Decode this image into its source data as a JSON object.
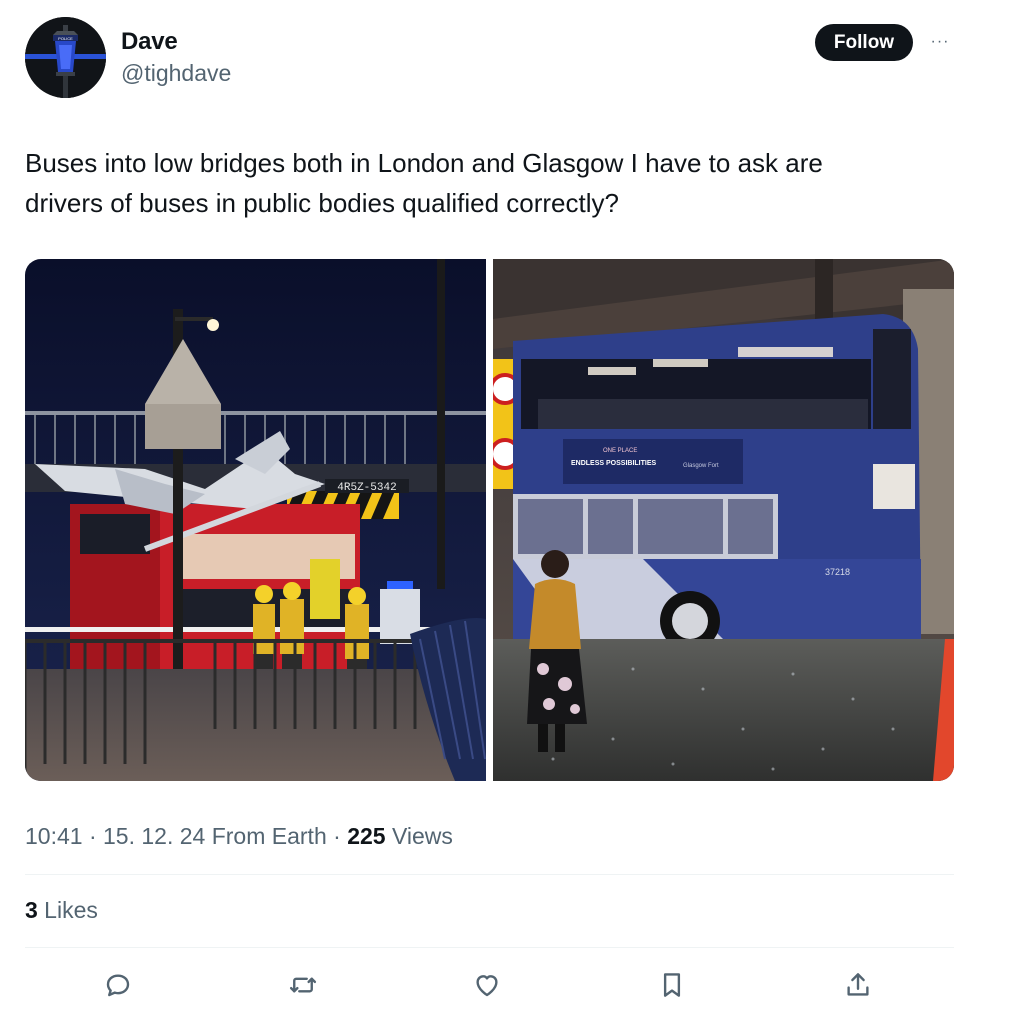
{
  "user": {
    "display_name": "Dave",
    "handle": "@tighdave",
    "follow_label": "Follow",
    "more_label": "···"
  },
  "tweet": {
    "lines": [
      "Buses into low bridges both in London and Glasgow I have to ask are",
      "drivers of buses in public bodies qualified correctly?"
    ]
  },
  "media": {
    "photos": [
      {
        "icon": "london-bus-crash-photo",
        "sign_text": "4R5Z-5342"
      },
      {
        "icon": "glasgow-bus-crash-photo",
        "ad_title": "ENDLESS POSSIBILITIES",
        "ad_kicker": "ONE PLACE",
        "ad_brand": "Glasgow Fort",
        "fleet_number": "37218"
      }
    ]
  },
  "meta": {
    "time": "10:41",
    "sep1": " · ",
    "date": "15. 12. 24",
    "source": " From Earth",
    "sep2": " · ",
    "views_count": "225",
    "views_label": " Views"
  },
  "stats": {
    "likes_count": "3",
    "likes_label": " Likes"
  },
  "actions": [
    {
      "icon": "reply-icon"
    },
    {
      "icon": "retweet-icon"
    },
    {
      "icon": "like-icon"
    },
    {
      "icon": "bookmark-icon"
    },
    {
      "icon": "share-icon"
    }
  ],
  "colors": {
    "text_primary": "#0f1419",
    "text_secondary": "#536471",
    "follow_bg": "#0f1419",
    "divider": "#eff3f4",
    "london_bus_red": "#d8262e",
    "glasgow_bus_navy": "#2e3f8a"
  }
}
